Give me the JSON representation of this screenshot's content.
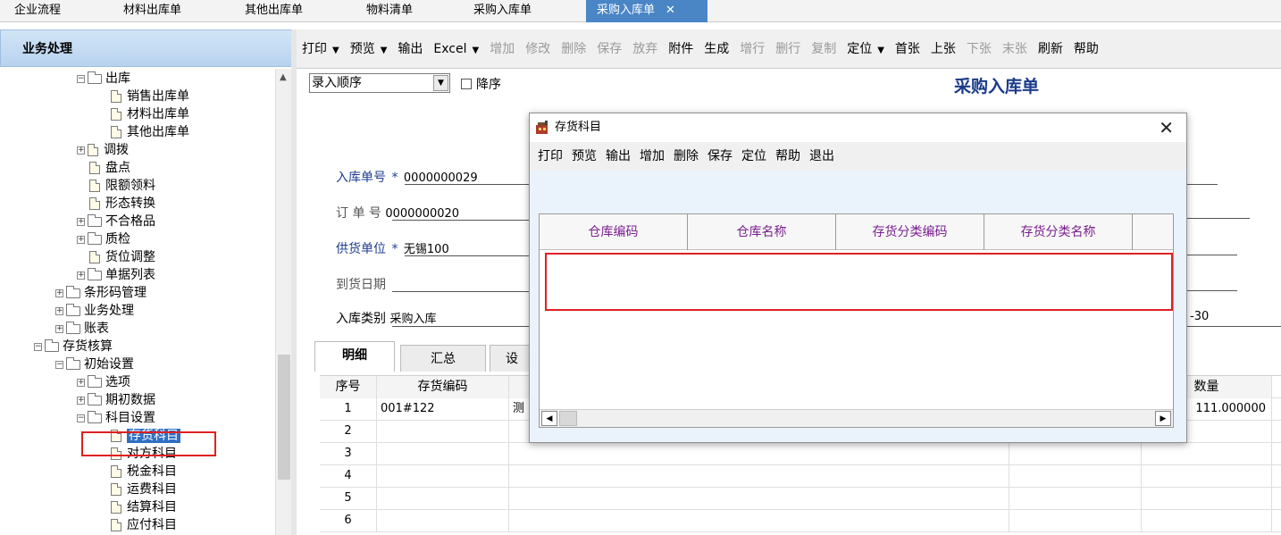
{
  "top_tabs": [
    {
      "label": "企业流程",
      "active": false
    },
    {
      "label": "材料出库单",
      "active": false
    },
    {
      "label": "其他出库单",
      "active": false
    },
    {
      "label": "物料清单",
      "active": false
    },
    {
      "label": "采购入库单",
      "active": false
    },
    {
      "label": "采购入库单",
      "active": true
    }
  ],
  "close_glyph": "✕",
  "left_panel": {
    "title": "业务处理",
    "tree": [
      {
        "label": "出库",
        "type": "folder",
        "expander": "−"
      },
      {
        "label": "销售出库单",
        "type": "doc"
      },
      {
        "label": "材料出库单",
        "type": "doc"
      },
      {
        "label": "其他出库单",
        "type": "doc"
      },
      {
        "label": "调拨",
        "type": "doc",
        "expander": "+"
      },
      {
        "label": "盘点",
        "type": "doc"
      },
      {
        "label": "限额领料",
        "type": "doc"
      },
      {
        "label": "形态转换",
        "type": "doc"
      },
      {
        "label": "不合格品",
        "type": "folder",
        "expander": "+"
      },
      {
        "label": "质检",
        "type": "folder",
        "expander": "+"
      },
      {
        "label": "货位调整",
        "type": "doc"
      },
      {
        "label": "单据列表",
        "type": "folder",
        "expander": "+"
      },
      {
        "label": "条形码管理",
        "type": "folder",
        "expander": "+"
      },
      {
        "label": "业务处理",
        "type": "folder",
        "expander": "+"
      },
      {
        "label": "账表",
        "type": "folder",
        "expander": "+"
      },
      {
        "label": "存货核算",
        "type": "folder",
        "expander": "−"
      },
      {
        "label": "初始设置",
        "type": "folder",
        "expander": "−"
      },
      {
        "label": "选项",
        "type": "folder",
        "expander": "+"
      },
      {
        "label": "期初数据",
        "type": "folder",
        "expander": "+"
      },
      {
        "label": "科目设置",
        "type": "folder",
        "expander": "−"
      },
      {
        "label": "存货科目",
        "type": "doc",
        "selected": true
      },
      {
        "label": "对方科目",
        "type": "doc"
      },
      {
        "label": "税金科目",
        "type": "doc"
      },
      {
        "label": "运费科目",
        "type": "doc"
      },
      {
        "label": "结算科目",
        "type": "doc"
      },
      {
        "label": "应付科目",
        "type": "doc"
      }
    ]
  },
  "toolbar": [
    {
      "label": "打印",
      "dropdown": true,
      "disabled": false
    },
    {
      "label": "预览",
      "dropdown": true,
      "disabled": false
    },
    {
      "label": "输出",
      "disabled": false
    },
    {
      "label": "Excel",
      "dropdown": true,
      "disabled": false
    },
    {
      "label": "增加",
      "disabled": true
    },
    {
      "label": "修改",
      "disabled": true
    },
    {
      "label": "删除",
      "disabled": true
    },
    {
      "label": "保存",
      "disabled": true
    },
    {
      "label": "放弃",
      "disabled": true
    },
    {
      "label": "附件",
      "disabled": false
    },
    {
      "label": "生成",
      "disabled": false
    },
    {
      "label": "增行",
      "disabled": true
    },
    {
      "label": "删行",
      "disabled": true
    },
    {
      "label": "复制",
      "disabled": true
    },
    {
      "label": "定位",
      "dropdown": true,
      "disabled": false
    },
    {
      "label": "首张",
      "disabled": false
    },
    {
      "label": "上张",
      "disabled": false
    },
    {
      "label": "下张",
      "disabled": true
    },
    {
      "label": "末张",
      "disabled": true
    },
    {
      "label": "刷新",
      "disabled": false
    },
    {
      "label": "帮助",
      "disabled": false
    }
  ],
  "dropdown_glyph": "▼",
  "form": {
    "sort_select": "录入顺序",
    "desc_checkbox": "降序",
    "title": "采购入库单",
    "fields": {
      "receipt_no_label": "入库单号",
      "receipt_no": "0000000029",
      "order_no_label": "订 单 号",
      "order_no": "0000000020",
      "supplier_label": "供货单位",
      "supplier": "无锡100",
      "arrival_label": "到货日期",
      "arrival": "",
      "category_label": "入库类别",
      "category": "采购入库",
      "right_tail": "-30"
    },
    "required_mark": "*"
  },
  "detail_tabs": [
    "明细",
    "汇总",
    "设"
  ],
  "grid": {
    "headers": {
      "seq": "序号",
      "code": "存货编码",
      "qty": "数量"
    },
    "rows": [
      {
        "seq": "1",
        "code": "001#122",
        "name": "测",
        "qty": "111.000000"
      },
      {
        "seq": "2",
        "code": "",
        "name": "",
        "qty": ""
      },
      {
        "seq": "3",
        "code": "",
        "name": "",
        "qty": ""
      },
      {
        "seq": "4",
        "code": "",
        "name": "",
        "qty": ""
      },
      {
        "seq": "5",
        "code": "",
        "name": "",
        "qty": ""
      },
      {
        "seq": "6",
        "code": "",
        "name": "",
        "qty": ""
      }
    ]
  },
  "dialog": {
    "title": "存货科目",
    "close": "✕",
    "toolbar": [
      "打印",
      "预览",
      "输出",
      "增加",
      "删除",
      "保存",
      "定位",
      "帮助",
      "退出"
    ],
    "columns": [
      "仓库编码",
      "仓库名称",
      "存货分类编码",
      "存货分类名称",
      ""
    ]
  },
  "colors": {
    "active_tab": "#4a86c6",
    "highlight": "#e02020",
    "title_blue": "#1a3a8a",
    "dialog_header_text": "#7a1f8e"
  }
}
